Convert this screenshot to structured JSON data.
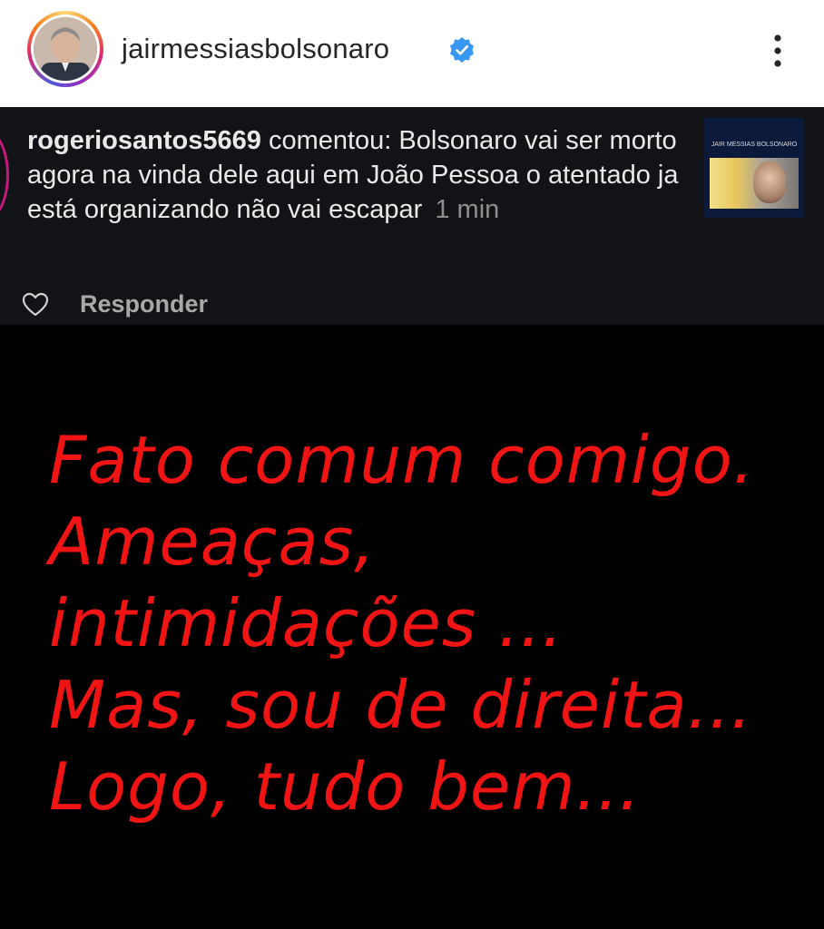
{
  "post": {
    "username": "jairmessiasbolsonaro",
    "verified_icon": "verified-badge-icon",
    "more_icon": "more-options-icon"
  },
  "comment": {
    "username": "rogeriosantos5669",
    "text": "comentou: Bolsonaro vai ser morto agora na vinda dele aqui em João Pessoa o atentado ja está organizando não vai escapar",
    "time": "1 min",
    "reply_label": "Responder",
    "like_icon": "heart-icon",
    "thumbnail_caption": "JAIR MESSIAS BOLSONARO"
  },
  "message": {
    "lines": [
      "Fato comum comigo.",
      "Ameaças,",
      "intimidações ...",
      "Mas, sou de direita...",
      "Logo, tudo bem..."
    ]
  },
  "colors": {
    "accent_red": "#f11414",
    "verified_blue": "#3897f0",
    "card_bg": "#121316"
  }
}
